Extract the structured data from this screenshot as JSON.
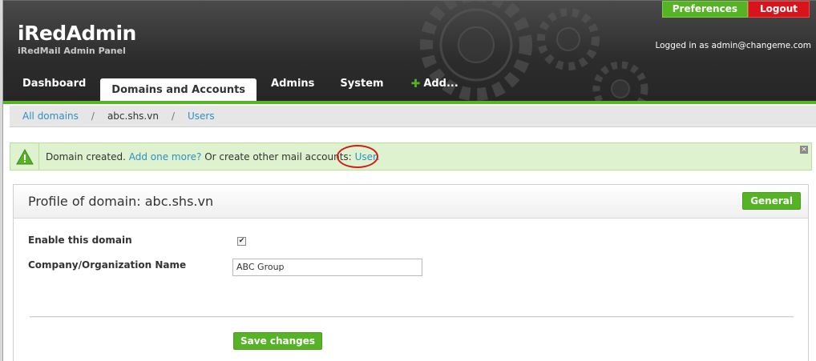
{
  "header": {
    "brand_title": "iRedAdmin",
    "brand_subtitle": "iRedMail Admin Panel",
    "logged_in_text": "Logged in as admin@changeme.com",
    "preferences_label": "Preferences",
    "logout_label": "Logout"
  },
  "nav": {
    "items": [
      {
        "label": "Dashboard"
      },
      {
        "label": "Domains and Accounts"
      },
      {
        "label": "Admins"
      },
      {
        "label": "System"
      },
      {
        "label": "Add..."
      }
    ]
  },
  "breadcrumb": {
    "all_domains": "All domains",
    "separator": "/",
    "domain": "abc.shs.vn",
    "users": "Users"
  },
  "notice": {
    "text_before": "Domain created.",
    "add_more_link": "Add one more?",
    "text_middle": "Or create other mail accounts:",
    "user_link": "User",
    "text_end": ".",
    "close_glyph": "×"
  },
  "panel": {
    "title": "Profile of domain: abc.shs.vn",
    "general_button": "General",
    "enable_label": "Enable this domain",
    "enable_checked": "✔",
    "company_label": "Company/Organization Name",
    "company_value": "ABC Group",
    "save_button": "Save changes"
  },
  "colors": {
    "accent_green": "#56b325",
    "logout_red": "#d8141a",
    "link_blue": "#2e8fc4",
    "header_dark": "#2c2c2c"
  }
}
